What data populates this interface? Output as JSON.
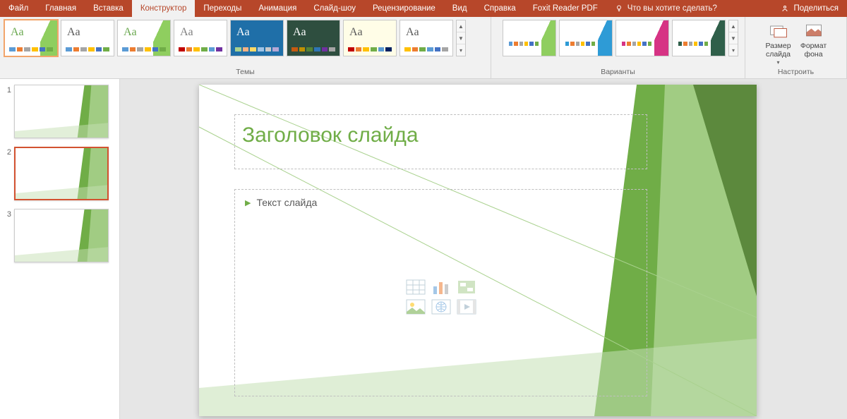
{
  "ribbon": {
    "tabs": [
      "Файл",
      "Главная",
      "Вставка",
      "Конструктор",
      "Переходы",
      "Анимация",
      "Слайд-шоу",
      "Рецензирование",
      "Вид",
      "Справка",
      "Foxit Reader PDF"
    ],
    "active_tab_index": 3,
    "tellme_placeholder": "Что вы хотите сделать?",
    "share_label": "Поделиться"
  },
  "groups": {
    "themes_label": "Темы",
    "variants_label": "Варианты",
    "customize_label": "Настроить",
    "slide_size_label": "Размер слайда",
    "format_bg_label": "Формат фона"
  },
  "themes": [
    {
      "aa_color": "#6aa84f",
      "bg": "#ffffff",
      "wedge": "#8fce5f",
      "dots": [
        "#5b9bd5",
        "#ed7d31",
        "#a5a5a5",
        "#ffc000",
        "#4472c4",
        "#70ad47"
      ],
      "selected": true
    },
    {
      "aa_color": "#595959",
      "bg": "#ffffff",
      "wedge": "",
      "dots": [
        "#5b9bd5",
        "#ed7d31",
        "#a5a5a5",
        "#ffc000",
        "#4472c4",
        "#70ad47"
      ]
    },
    {
      "aa_color": "#6aa84f",
      "bg": "#ffffff",
      "wedge": "#8fce5f",
      "dots": [
        "#5b9bd5",
        "#ed7d31",
        "#a5a5a5",
        "#ffc000",
        "#4472c4",
        "#70ad47"
      ]
    },
    {
      "aa_color": "#7f7f7f",
      "bg": "#ffffff",
      "wedge": "",
      "dots": [
        "#c00000",
        "#ed7d31",
        "#ffc000",
        "#70ad47",
        "#5b9bd5",
        "#7030a0"
      ]
    },
    {
      "aa_color": "#ffffff",
      "bg": "#1f6fa8",
      "wedge": "",
      "dots": [
        "#a9d18e",
        "#f4b183",
        "#ffd966",
        "#9dc3e6",
        "#c9c9c9",
        "#b4a7d6"
      ]
    },
    {
      "aa_color": "#ffffff",
      "bg": "#2e4e3f",
      "wedge": "",
      "dots": [
        "#c55a11",
        "#bf9000",
        "#548235",
        "#2e75b6",
        "#7030a0",
        "#a5a5a5"
      ]
    },
    {
      "aa_color": "#595959",
      "bg": "#fffde7",
      "wedge": "",
      "dots": [
        "#c00000",
        "#ed7d31",
        "#ffc000",
        "#70ad47",
        "#5b9bd5",
        "#002060"
      ]
    },
    {
      "aa_color": "#595959",
      "bg": "#ffffff",
      "wedge": "",
      "dots": [
        "#ffc000",
        "#ed7d31",
        "#70ad47",
        "#5b9bd5",
        "#4472c4",
        "#a5a5a5"
      ]
    }
  ],
  "variants": [
    {
      "wedge": "#8fce5f",
      "dots": [
        "#5b9bd5",
        "#ed7d31",
        "#a5a5a5",
        "#ffc000",
        "#4472c4",
        "#70ad47"
      ]
    },
    {
      "wedge": "#2e9bd6",
      "dots": [
        "#2e9bd6",
        "#ed7d31",
        "#a5a5a5",
        "#ffc000",
        "#4472c4",
        "#70ad47"
      ]
    },
    {
      "wedge": "#d63384",
      "dots": [
        "#d63384",
        "#ed7d31",
        "#a5a5a5",
        "#ffc000",
        "#4472c4",
        "#70ad47"
      ]
    },
    {
      "wedge": "#2f5f4a",
      "dots": [
        "#2f5f4a",
        "#ed7d31",
        "#a5a5a5",
        "#ffc000",
        "#4472c4",
        "#70ad47"
      ]
    }
  ],
  "slides": {
    "count": 3,
    "selected_index": 2,
    "numbers": [
      "1",
      "2",
      "3"
    ]
  },
  "canvas": {
    "title_placeholder": "Заголовок слайда",
    "content_placeholder": "Текст слайда"
  }
}
